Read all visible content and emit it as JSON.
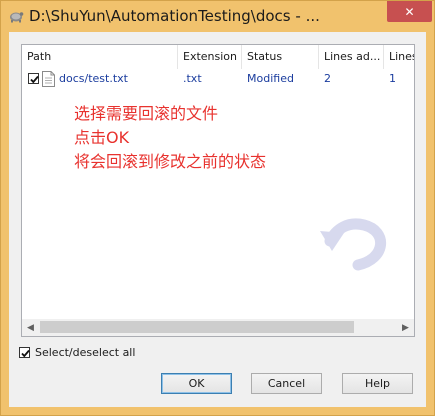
{
  "window": {
    "title": "D:\\ShuYun\\AutomationTesting\\docs - ...",
    "close_glyph": "✕"
  },
  "list": {
    "columns": [
      "Path",
      "Extension",
      "Status",
      "Lines ad...",
      "Lines"
    ],
    "rows": [
      {
        "checked": true,
        "path": "docs/test.txt",
        "extension": ".txt",
        "status": "Modified",
        "lines_added": "2",
        "lines_removed": "1"
      }
    ]
  },
  "annotation": {
    "line1": "选择需要回滚的文件",
    "line2": "点击OK",
    "line3": "将会回滚到修改之前的状态",
    "color": "#e8322e"
  },
  "select_all": {
    "checked": true,
    "label": "Select/deselect all"
  },
  "buttons": {
    "ok": "OK",
    "cancel": "Cancel",
    "help": "Help"
  },
  "scrollbar": {
    "left_glyph": "◀",
    "right_glyph": "▶"
  }
}
